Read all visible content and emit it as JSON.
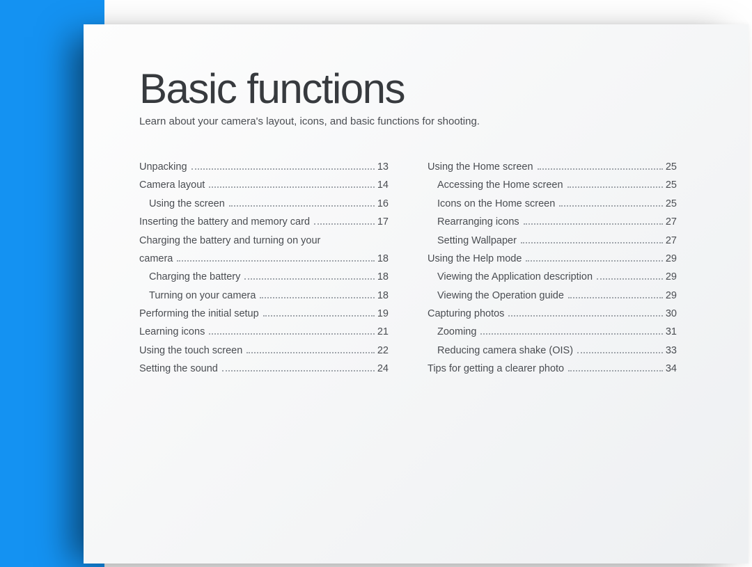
{
  "title": "Basic functions",
  "subtitle": "Learn about your camera's layout, icons, and basic functions for shooting.",
  "left": [
    {
      "label": "Unpacking",
      "page": "13",
      "sub": false
    },
    {
      "label": "Camera layout",
      "page": "14",
      "sub": false
    },
    {
      "label": "Using the screen",
      "page": "16",
      "sub": true
    },
    {
      "label": "Inserting the battery and memory card",
      "page": "17",
      "sub": false
    },
    {
      "wrap": "Charging the battery and turning on your",
      "label": "camera",
      "page": "18",
      "sub": false
    },
    {
      "label": "Charging the battery",
      "page": "18",
      "sub": true
    },
    {
      "label": "Turning on your camera",
      "page": "18",
      "sub": true
    },
    {
      "label": "Performing the initial setup",
      "page": "19",
      "sub": false
    },
    {
      "label": "Learning icons",
      "page": "21",
      "sub": false
    },
    {
      "label": "Using the touch screen",
      "page": "22",
      "sub": false
    },
    {
      "label": "Setting the sound",
      "page": "24",
      "sub": false
    }
  ],
  "right": [
    {
      "label": "Using the Home screen",
      "page": "25",
      "sub": false
    },
    {
      "label": "Accessing the Home screen",
      "page": "25",
      "sub": true
    },
    {
      "label": "Icons on the Home screen",
      "page": "25",
      "sub": true
    },
    {
      "label": "Rearranging icons",
      "page": "27",
      "sub": true
    },
    {
      "label": "Setting Wallpaper",
      "page": "27",
      "sub": true
    },
    {
      "label": "Using the Help mode",
      "page": "29",
      "sub": false
    },
    {
      "label": "Viewing the Application description",
      "page": "29",
      "sub": true
    },
    {
      "label": "Viewing the Operation guide",
      "page": "29",
      "sub": true
    },
    {
      "label": "Capturing photos",
      "page": "30",
      "sub": false
    },
    {
      "label": "Zooming",
      "page": "31",
      "sub": true
    },
    {
      "label": "Reducing camera shake (OIS)",
      "page": "33",
      "sub": true
    },
    {
      "label": "Tips for getting a clearer photo",
      "page": "34",
      "sub": false
    }
  ]
}
